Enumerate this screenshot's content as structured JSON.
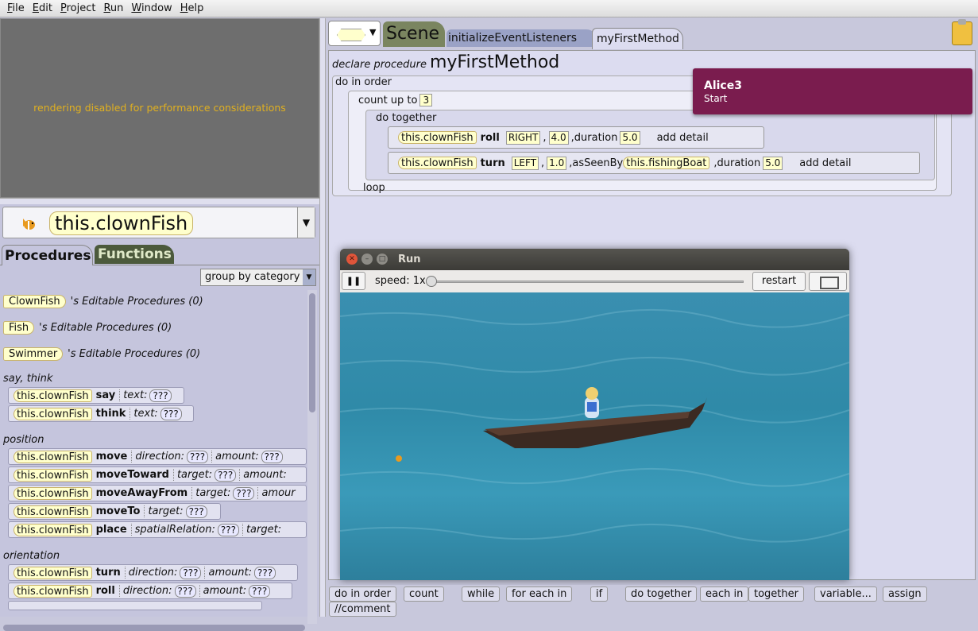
{
  "menu": [
    "File",
    "Edit",
    "Project",
    "Run",
    "Window",
    "Help"
  ],
  "menu_mnemonics": [
    "F",
    "E",
    "P",
    "R",
    "W",
    "H"
  ],
  "menu_rest": [
    "ile",
    "dit",
    "roject",
    "un",
    "indow",
    "elp"
  ],
  "preview": {
    "message": "rendering disabled for performance considerations"
  },
  "selector": {
    "object": "this.clownFish"
  },
  "left_tabs": {
    "procedures": "Procedures",
    "functions": "Functions"
  },
  "group_by": "group by category",
  "editable": [
    {
      "type": "ClownFish",
      "label": "'s Editable Procedures (0)"
    },
    {
      "type": "Fish",
      "label": "'s Editable Procedures (0)"
    },
    {
      "type": "Swimmer",
      "label": "'s Editable Procedures (0)"
    }
  ],
  "categories": {
    "say": "say, think",
    "position": "position",
    "orientation": "orientation"
  },
  "tiles": {
    "obj": "this.clownFish",
    "unk": "???",
    "say": {
      "m": "say",
      "a1": "text:"
    },
    "think": {
      "m": "think",
      "a1": "text:"
    },
    "move": {
      "m": "move",
      "a1": "direction:",
      "a2": "amount:"
    },
    "moveToward": {
      "m": "moveToward",
      "a1": "target:",
      "a2": "amount:"
    },
    "moveAwayFrom": {
      "m": "moveAwayFrom",
      "a1": "target:",
      "a2": "amour"
    },
    "moveTo": {
      "m": "moveTo",
      "a1": "target:"
    },
    "place": {
      "m": "place",
      "a1": "spatialRelation:",
      "a2": "target:"
    },
    "turn": {
      "m": "turn",
      "a1": "direction:",
      "a2": "amount:"
    },
    "roll": {
      "m": "roll",
      "a1": "direction:",
      "a2": "amount:"
    }
  },
  "editor_tabs": {
    "scene": "Scene",
    "init": "initializeEventListeners",
    "my": "myFirstMethod"
  },
  "editor": {
    "declare": "declare procedure",
    "method": "myFirstMethod",
    "do_in_order": "do in order",
    "count_up_to": "count up to",
    "count_val": "3",
    "do_together": "do together",
    "loop": "loop",
    "s1": {
      "obj": "this.clownFish",
      "m": "roll",
      "dir": "RIGHT",
      "amt": "4.0",
      "dl": "duration",
      "dur": "5.0",
      "add": "add detail"
    },
    "s2": {
      "obj": "this.clownFish",
      "m": "turn",
      "dir": "LEFT",
      "amt": "1.0",
      "asl": "asSeenBy",
      "as": "this.fishingBoat",
      "dl": "duration",
      "dur": "5.0",
      "add": "add detail"
    }
  },
  "notification": {
    "title": "Alice3",
    "body": "Start"
  },
  "run_window": {
    "title": "Run",
    "speed": "speed: 1x",
    "restart": "restart"
  },
  "palette": [
    "do in order",
    "count",
    "while",
    "for each in",
    "if",
    "do together",
    "each in",
    "together",
    "variable...",
    "assign",
    "//comment"
  ],
  "colors": {
    "notification": "#7a1c4e",
    "object_tile": "#ffffcc",
    "functions_tab": "#4c5a3c",
    "scene_tab": "#7a8560"
  }
}
